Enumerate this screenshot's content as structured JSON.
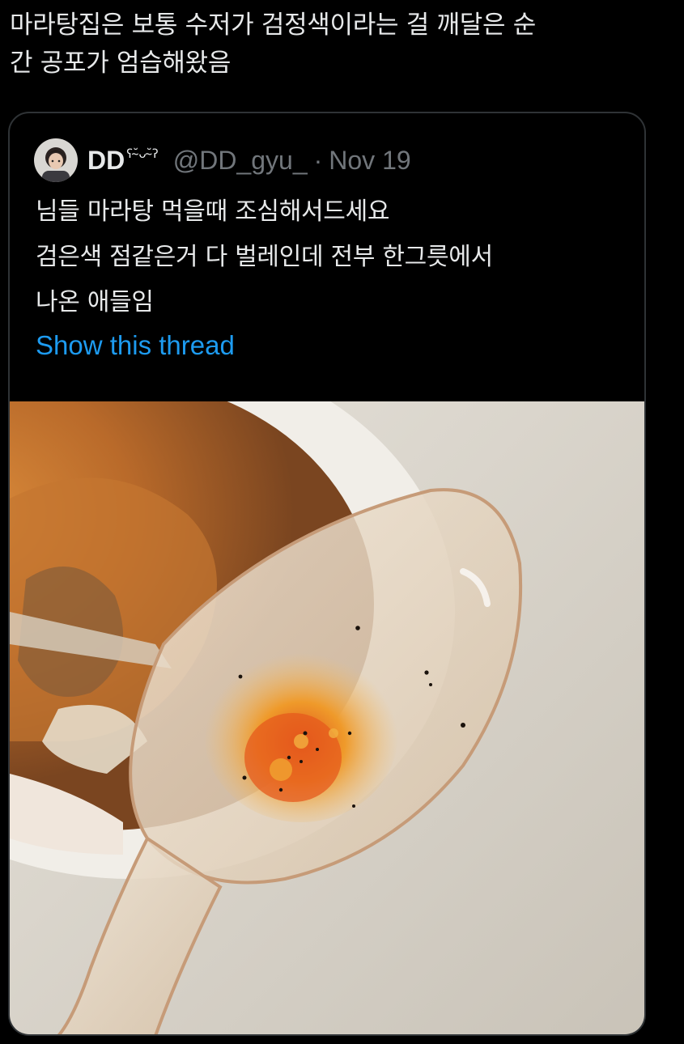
{
  "tweet": {
    "text_lines": [
      "마라탕집은 보통 수저가 검정색이라는 걸 깨달은 순",
      "간 공포가 엄습해왔음"
    ]
  },
  "quoted_tweet": {
    "display_name": "DD",
    "name_emoji": "ʕ˘̴ᴗ˘̴ʔ",
    "handle": "@DD_gyu_",
    "separator": "·",
    "date": "Nov 19",
    "text_lines": [
      "님들 마라탕 먹을때 조심해서드세요",
      "검은색 점같은거 다 벌레인데 전부 한그릇에서",
      "나온 애들임"
    ],
    "show_thread_label": "Show this thread",
    "media": {
      "icon": "photo-of-spoon-with-broth"
    }
  },
  "colors": {
    "background": "#000000",
    "text": "#e7e9ea",
    "secondary_text": "#71767b",
    "link": "#1d9bf0",
    "border": "#2f3336"
  }
}
